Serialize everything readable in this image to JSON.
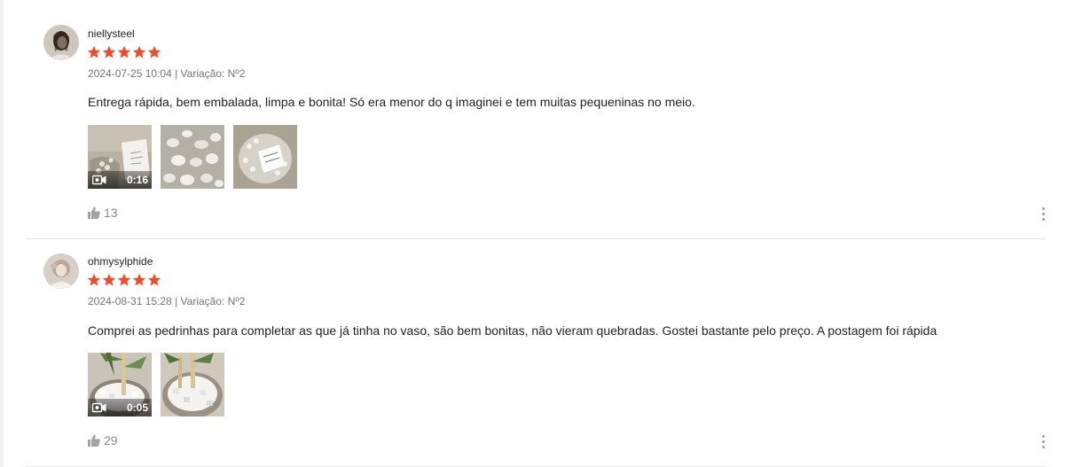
{
  "colors": {
    "star": "#ee4d2d",
    "meta": "#757575",
    "divider": "#e5e5e5"
  },
  "reviews": [
    {
      "username": "niellysteel",
      "rating": 5,
      "meta": "2024-07-25 10:04 | Variação: Nº2",
      "text": "Entrega rápida, bem embalada, limpa e bonita! Só era menor do q imaginei e tem muitas pequeninas no meio.",
      "video_duration": "0:16",
      "likes": "13",
      "icons": {
        "like": "thumbs-up-icon",
        "more": "more-vertical-icon",
        "video": "video-camera-icon"
      }
    },
    {
      "username": "ohmysylphide",
      "rating": 5,
      "meta": "2024-08-31 15:28 | Variação: Nº2",
      "text": "Comprei as pedrinhas para completar as que já tinha no vaso, são bem bonitas, não vieram quebradas. Gostei bastante pelo preço. A postagem foi rápida",
      "video_duration": "0:05",
      "likes": "29",
      "icons": {
        "like": "thumbs-up-icon",
        "more": "more-vertical-icon",
        "video": "video-camera-icon"
      }
    }
  ]
}
